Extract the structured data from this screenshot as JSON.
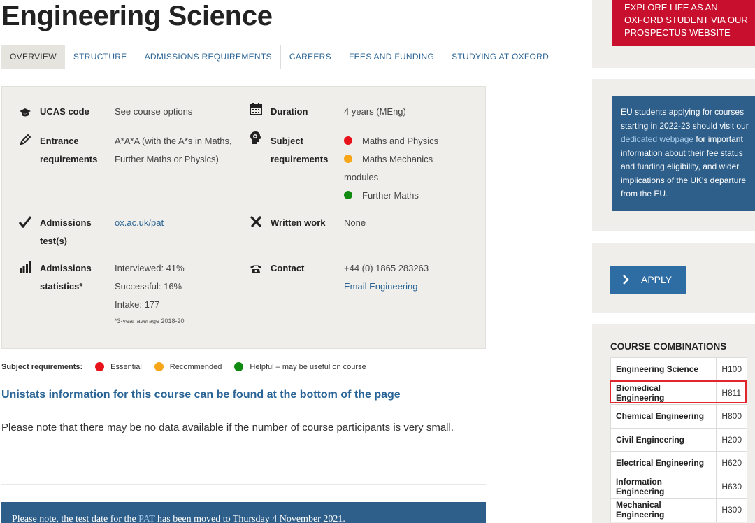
{
  "page": {
    "title": "Engineering Science"
  },
  "tabs": [
    "OVERVIEW",
    "STRUCTURE",
    "ADMISSIONS REQUIREMENTS",
    "CAREERS",
    "FEES AND FUNDING",
    "STUDYING AT OXFORD"
  ],
  "info": {
    "ucas_label": "UCAS code",
    "ucas_value": "See course options",
    "duration_label": "Duration",
    "duration_value": "4 years (MEng)",
    "entrance_label_1": "Entrance",
    "entrance_label_2": "requirements",
    "entrance_value_1": "A*A*A (with the A*s in Maths,",
    "entrance_value_2": "Further Maths or Physics)",
    "subject_label_1": "Subject",
    "subject_label_2": "requirements",
    "subject_req_1": "Maths and Physics",
    "subject_req_2a": "Maths Mechanics",
    "subject_req_2b": "modules",
    "subject_req_3": "Further Maths",
    "tests_label_1": "Admissions",
    "tests_label_2": "test(s)",
    "tests_value": "ox.ac.uk/pat",
    "written_label": "Written work",
    "written_value": "None",
    "stats_label_1": "Admissions",
    "stats_label_2": "statistics*",
    "stats_interviewed": "Interviewed: 41%",
    "stats_successful": "Successful: 16%",
    "stats_intake": "Intake: 177",
    "stats_note": "*3-year average 2018-20",
    "contact_label": "Contact",
    "contact_phone": "+44 (0) 1865 283263",
    "contact_email": "Email Engineering"
  },
  "legend": {
    "label": "Subject requirements:",
    "essential": "Essential",
    "recommended": "Recommended",
    "helpful": "Helpful – may be useful on course"
  },
  "unistats": "Unistats information for this course can be found at the bottom of the page",
  "note": "Please note that there may be no data available if the number of course participants is very small.",
  "pat_banner": {
    "before": "Please note, the test date for the ",
    "link": "PAT",
    "after": " has been moved to Thursday 4 November 2021."
  },
  "sidebar": {
    "explore": "EXPLORE LIFE AS AN OXFORD STUDENT VIA OUR PROSPECTUS WEBSITE",
    "eu_before": "EU students applying for courses starting in 2022-23 should visit our ",
    "eu_link": "dedicated webpage",
    "eu_after": " for important information about their fee status and funding eligibility, and wider implications of the UK's departure from the EU.",
    "apply": "APPLY",
    "combos_title": "COURSE COMBINATIONS",
    "combos": [
      {
        "name": "Engineering Science",
        "code": "H100"
      },
      {
        "name": "Biomedical Engineering",
        "code": "H811"
      },
      {
        "name": "Chemical Engineering",
        "code": "H800"
      },
      {
        "name": "Civil Engineering",
        "code": "H200"
      },
      {
        "name": "Electrical Engineering",
        "code": "H620"
      },
      {
        "name": "Information Engineering",
        "code": "H630"
      },
      {
        "name": "Mechanical Engineering",
        "code": "H300"
      }
    ]
  },
  "colors": {
    "essential": "#e8121b",
    "recommended": "#f6a618",
    "helpful": "#108a10",
    "link": "#2a6496",
    "banner": "#2e5f8a",
    "explore": "#c8102e",
    "highlight": "#e1262d"
  }
}
